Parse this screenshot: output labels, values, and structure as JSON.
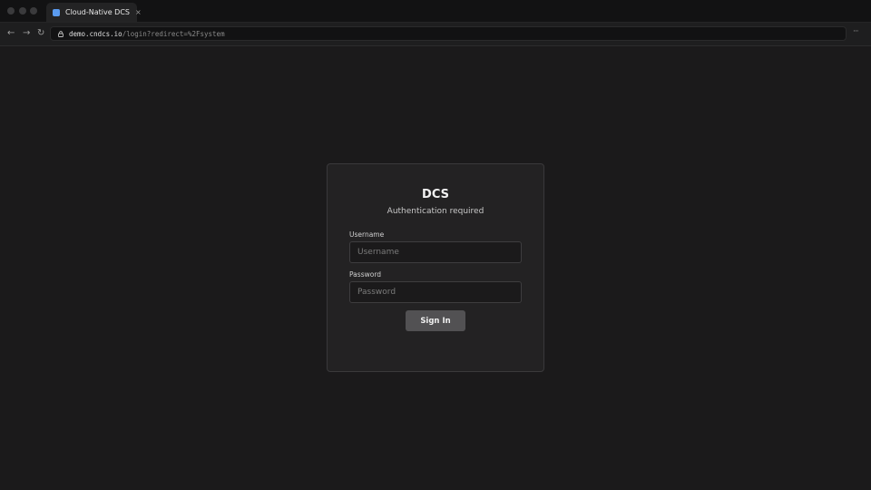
{
  "browser": {
    "tab": {
      "title": "Cloud-Native DCS",
      "close": "×",
      "favicon_color": "#5a9bf0"
    },
    "nav": {
      "back": "←",
      "forward": "→",
      "reload": "↻"
    },
    "url": {
      "host": "demo.cndcs.io",
      "path": "/login?redirect=%2Fsystem"
    },
    "menu": "···"
  },
  "login": {
    "title": "DCS",
    "subtitle": "Authentication required",
    "username_label": "Username",
    "username_value": "",
    "username_placeholder": "Username",
    "password_label": "Password",
    "password_value": "",
    "password_placeholder": "Password",
    "submit_label": "Sign In"
  }
}
